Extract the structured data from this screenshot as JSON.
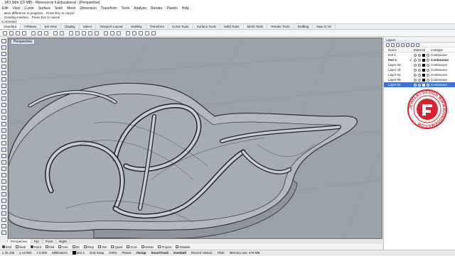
{
  "window": {
    "title": "...MO.3dm (19 MB) - Rhinoceros 6 Educational - [Perspective]"
  },
  "menu": [
    "Edit",
    "View",
    "Curve",
    "Surface",
    "Solid",
    "Mesh",
    "Dimension",
    "Transform",
    "Tools",
    "Analyze",
    "Render",
    "Panels",
    "Help"
  ],
  "command": {
    "line1": "...ation difference in progress... Press Esc to cancel",
    "line2": "...Creating meshes... Press Esc to cancel",
    "line3": "Command:"
  },
  "tabs": [
    "Standard",
    "CPlanes",
    "Set View",
    "Display",
    "Select",
    "Viewport Layout",
    "Visibility",
    "Transform",
    "Curve Tools",
    "Surface Tools",
    "Solid Tools",
    "Mesh Tools",
    "Render Tools",
    "Drafting",
    "New in V6"
  ],
  "active_tab": "Standard",
  "viewport": {
    "label": "Perspective"
  },
  "viewport_tabs": [
    "Perspective",
    "Top",
    "Front",
    "Right"
  ],
  "osnaps": [
    {
      "label": "End",
      "checked": true
    },
    {
      "label": "Near",
      "checked": false
    },
    {
      "label": "Point",
      "checked": true
    },
    {
      "label": "Mid",
      "checked": false
    },
    {
      "label": "Cen",
      "checked": false
    },
    {
      "label": "Int",
      "checked": false
    },
    {
      "label": "Perp",
      "checked": false
    },
    {
      "label": "Tan",
      "checked": false
    },
    {
      "label": "Quad",
      "checked": false
    },
    {
      "label": "Knot",
      "checked": false
    },
    {
      "label": "Vertex",
      "checked": false
    },
    {
      "label": "Project",
      "checked": false
    },
    {
      "label": "Disable",
      "checked": false
    }
  ],
  "status": {
    "x": "x 25.155",
    "y": "y 14.993",
    "z": "z 0.000",
    "units": "Millimeters",
    "layer": "text 2",
    "grid_snap": "Grid Snap",
    "ortho": "Ortho",
    "planar": "Planar",
    "osnap": "Osnap",
    "smarttrack": "SmartTrack",
    "gumball": "Gumball",
    "record_history": "Record History",
    "filter": "Filter",
    "memory": "Memory use: 478 MB"
  },
  "layers_panel": {
    "tabs": [
      "Layers"
    ],
    "columns": {
      "name": "Name",
      "material": "Material",
      "linetype": "Linetype"
    },
    "rows": [
      {
        "name": "text 1",
        "check": "",
        "linetype": "Continuous",
        "current": false,
        "selected": false
      },
      {
        "name": "text 2",
        "check": "✓",
        "linetype": "Continuous",
        "current": true,
        "selected": false
      },
      {
        "name": "Layer 03",
        "check": "",
        "linetype": "Continuous",
        "current": false,
        "selected": false
      },
      {
        "name": "Layer 04",
        "check": "",
        "linetype": "Continuous",
        "current": false,
        "selected": false
      },
      {
        "name": "Layer 01",
        "check": "",
        "linetype": "Continuous",
        "current": false,
        "selected": false
      },
      {
        "name": "Layer 05",
        "check": "",
        "linetype": "Continuous",
        "current": false,
        "selected": false
      },
      {
        "name": "Layer 02",
        "check": "",
        "linetype": "Continuous",
        "current": false,
        "selected": true
      }
    ]
  },
  "watermark": {
    "text": "JEWELRY DESIGN WWW.RHINOGEMS.COM",
    "color": "#d9232a"
  }
}
